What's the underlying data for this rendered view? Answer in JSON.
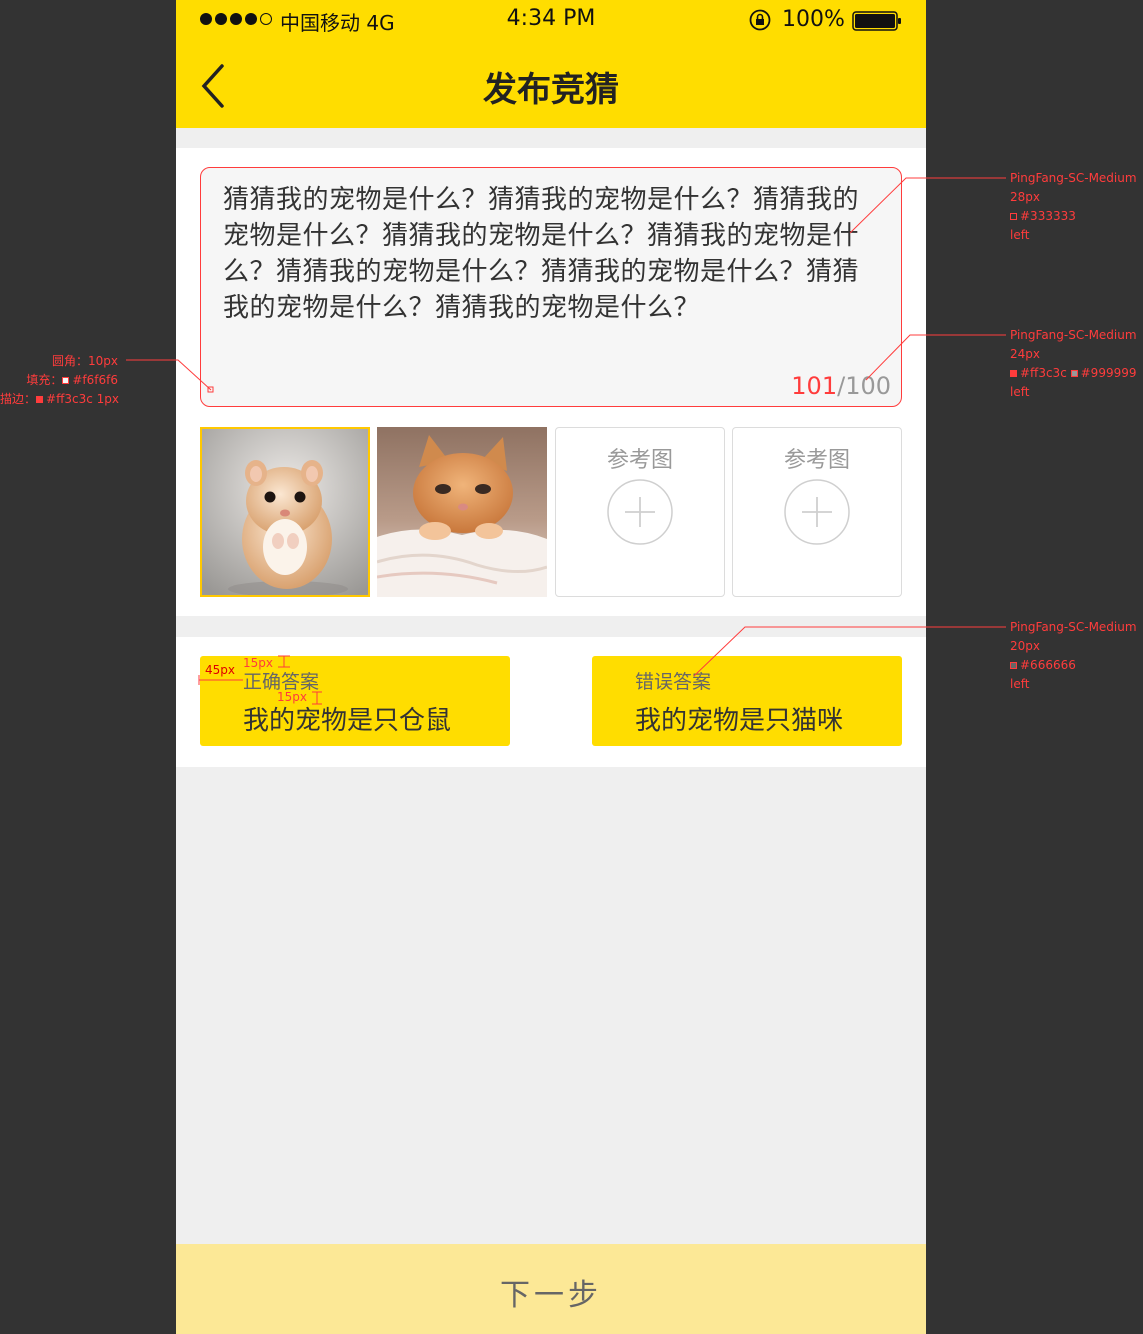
{
  "status_bar": {
    "carrier": "中国移动  4G",
    "time": "4:34 PM",
    "battery": "100%"
  },
  "header": {
    "title": "发布竞猜"
  },
  "question": {
    "text": "猜猜我的宠物是什么？猜猜我的宠物是什么？猜猜我的宠物是什么？猜猜我的宠物是什么？猜猜我的宠物是什么？猜猜我的宠物是什么？猜猜我的宠物是什么？猜猜我的宠物是什么？猜猜我的宠物是什么？",
    "count_current": "101",
    "count_separator": "/",
    "count_max": "100"
  },
  "images": [
    {
      "name": "hamster",
      "selected": true
    },
    {
      "name": "kitten",
      "selected": false
    },
    {
      "placeholder": "参考图"
    },
    {
      "placeholder": "参考图"
    }
  ],
  "answers": {
    "correct": {
      "label": "正确答案",
      "text": "我的宠物是只仓鼠"
    },
    "wrong": {
      "label": "错误答案",
      "text": "我的宠物是只猫咪"
    }
  },
  "footer": {
    "next_label": "下一步"
  },
  "annotations": {
    "question_font": [
      "PingFang-SC-Medium",
      "28px",
      "#333333",
      "left"
    ],
    "counter_font": [
      "PingFang-SC-Medium",
      "24px",
      "#ff3c3c",
      "#999999",
      "left"
    ],
    "answer_font": [
      "PingFang-SC-Medium",
      "20px",
      "#666666",
      "left"
    ],
    "textbox_style": [
      "圆角：10px",
      "填充：",
      "#f6f6f6",
      "描边：",
      "#ff3c3c 1px"
    ],
    "spacing": [
      "45px",
      "15px",
      "15px"
    ]
  },
  "colors": {
    "brand_yellow": "#ffdd00",
    "error_red": "#ff3c3c",
    "next_bar": "#fce896"
  }
}
